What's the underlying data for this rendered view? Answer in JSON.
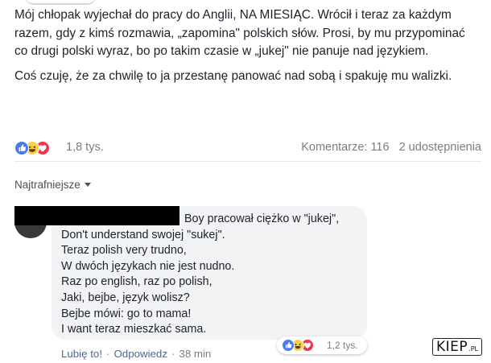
{
  "post": {
    "paragraph1": "Mój chłopak wyjechał do pracy do Anglii, NA MIESIĄC. Wrócił i teraz za każdym razem, gdy z kimś rozmawia, „zapomina\" polskich słów. Prosi, by mu przypominać co drugi polski wyraz, bo po takim czasie w „jukej\" nie panuje nad językiem.",
    "paragraph2": "Coś czuję, że za chwilę to ja przestanę panować nad sobą i spakuję mu walizki.",
    "reaction_count": "1,8 tys.",
    "comments_count": "Komentarze: 116",
    "shares_count": "2 udostępnienia"
  },
  "sort": {
    "label": "Najtrafniejsze"
  },
  "comment": {
    "lines": [
      "Boy pracował ciężko w \"jukej\",",
      "Don't understand swojej \"sukej\".",
      "Teraz polish very trudno,",
      "W dwóch językach nie jest nudno.",
      "Raz po english, raz po polish,",
      "Jaki, bejbe, język wolisz?",
      "Bejbe mówi: go to mama!",
      "I want teraz mieszkać sama."
    ],
    "reaction_count": "1,2 tys.",
    "like_label": "Lubię to!",
    "reply_label": "Odpowiedz",
    "time": "38 min"
  },
  "reactions": {
    "icons": [
      "like-icon",
      "haha-icon",
      "love-icon"
    ]
  },
  "watermark": {
    "big": "KIEP",
    "small": ".PL"
  },
  "colors": {
    "like": "#4b79f0",
    "haha": "#f7d14a",
    "love": "#f0354f",
    "link": "#4b67a1",
    "muted": "#7a7d83"
  }
}
